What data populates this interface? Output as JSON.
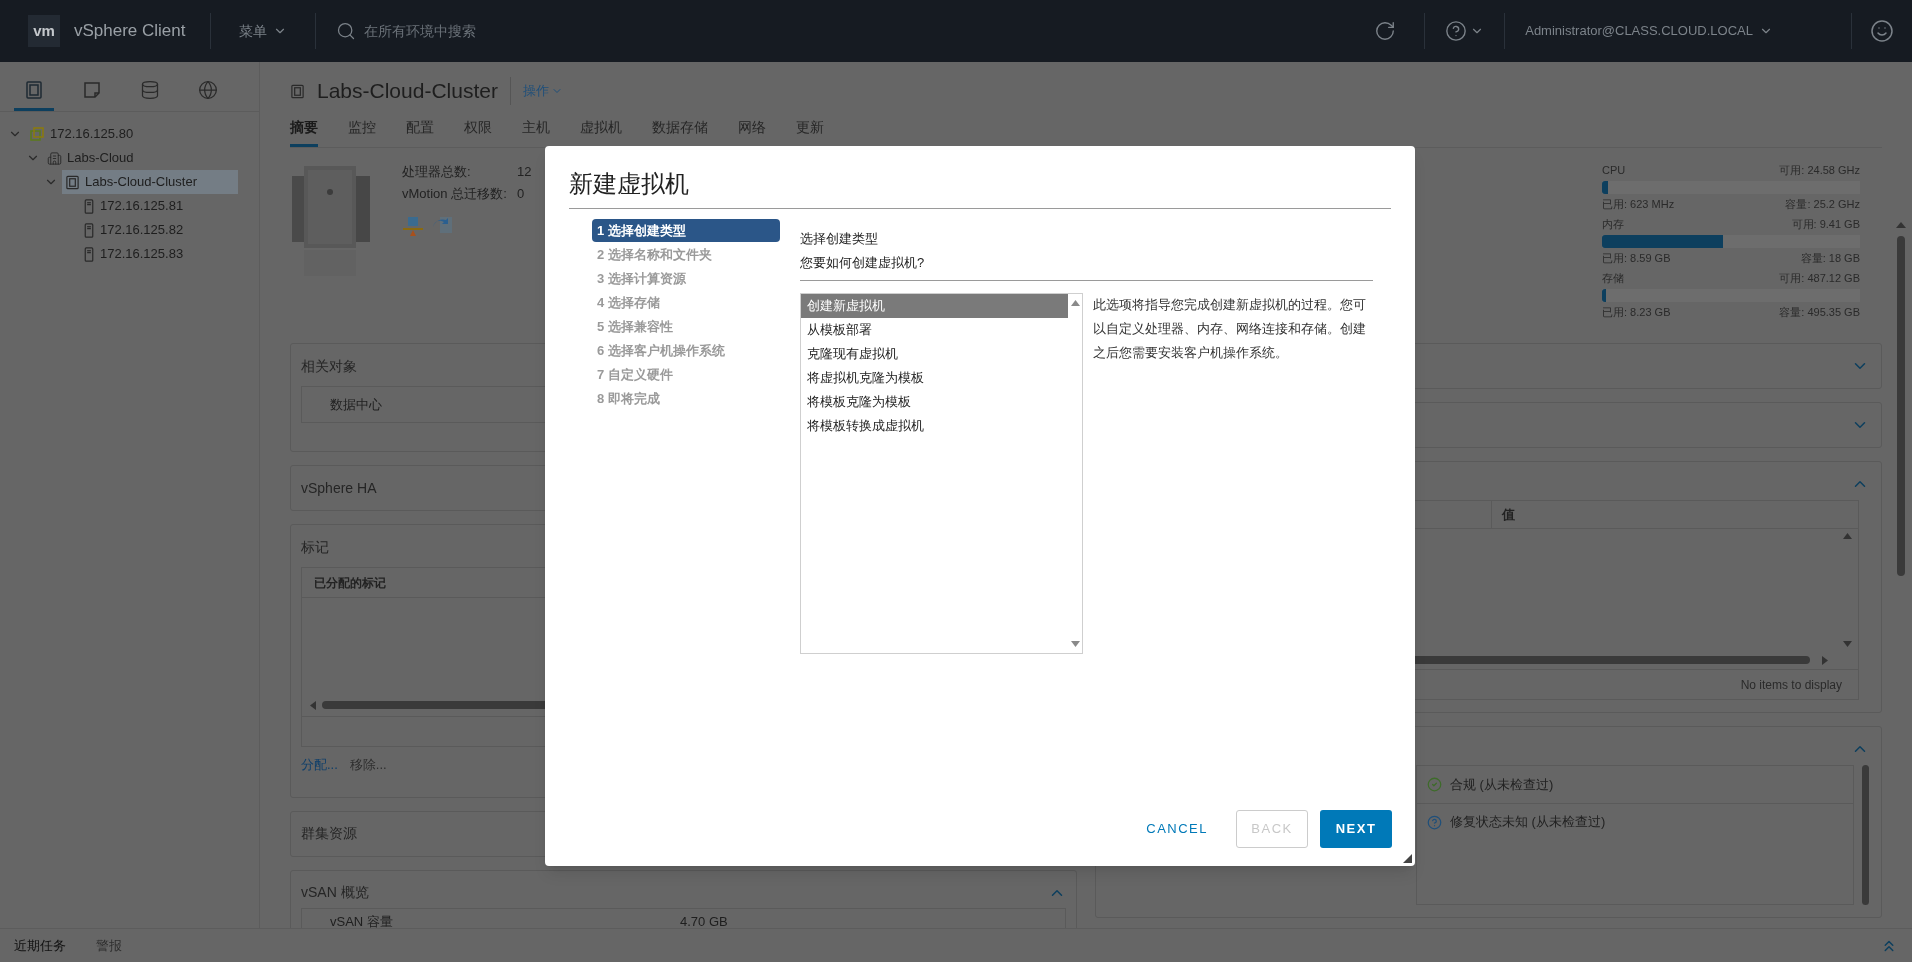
{
  "top_bar": {
    "logo": "vm",
    "app_name": "vSphere Client",
    "menu": "菜单",
    "search_placeholder": "在所有环境中搜索",
    "user": "Administrator@CLASS.CLOUD.LOCAL"
  },
  "sidebar": {
    "tabs": [
      {
        "kind": "hosts",
        "selected": true
      },
      {
        "kind": "vms",
        "selected": false
      },
      {
        "kind": "storage",
        "selected": false
      },
      {
        "kind": "network",
        "selected": false
      }
    ],
    "tree": [
      {
        "label": "172.16.125.80",
        "kind": "vcenter",
        "expanded": true,
        "selected": false,
        "children": [
          {
            "label": "Labs-Cloud",
            "kind": "datacenter",
            "expanded": true,
            "selected": false,
            "children": [
              {
                "label": "Labs-Cloud-Cluster",
                "kind": "cluster",
                "expanded": true,
                "selected": true,
                "children": [
                  {
                    "label": "172.16.125.81",
                    "kind": "host",
                    "selected": false
                  },
                  {
                    "label": "172.16.125.82",
                    "kind": "host",
                    "selected": false
                  },
                  {
                    "label": "172.16.125.83",
                    "kind": "host",
                    "selected": false
                  }
                ]
              }
            ]
          }
        ]
      }
    ]
  },
  "object": {
    "title": "Labs-Cloud-Cluster",
    "actions": "操作"
  },
  "tabs": [
    {
      "label": "摘要",
      "selected": true
    },
    {
      "label": "监控",
      "selected": false
    },
    {
      "label": "配置",
      "selected": false
    },
    {
      "label": "权限",
      "selected": false
    },
    {
      "label": "主机",
      "selected": false
    },
    {
      "label": "虚拟机",
      "selected": false
    },
    {
      "label": "数据存储",
      "selected": false
    },
    {
      "label": "网络",
      "selected": false
    },
    {
      "label": "更新",
      "selected": false
    }
  ],
  "summary": {
    "fields": [
      {
        "label": "处理器总数:",
        "value": "12"
      },
      {
        "label": "vMotion 总迁移数:",
        "value": "0"
      }
    ]
  },
  "resources": [
    {
      "name": "CPU",
      "free": "可用: 24.58 GHz",
      "used": "已用: 623 MHz",
      "capacity": "容量: 25.2 GHz",
      "level": 0.025
    },
    {
      "name": "内存",
      "free": "可用: 9.41 GB",
      "used": "已用: 8.59 GB",
      "capacity": "容量: 18 GB",
      "level": 0.47
    },
    {
      "name": "存储",
      "free": "可用: 487.12 GB",
      "used": "已用: 8.23 GB",
      "capacity": "容量: 495.35 GB",
      "level": 0.017
    }
  ],
  "left_cards": [
    {
      "kind": "related",
      "title": "相关对象",
      "expanded": true,
      "items": [
        "数据中心"
      ]
    },
    {
      "kind": "plain",
      "title": "vSphere HA",
      "expanded": false
    },
    {
      "kind": "tags",
      "title": "标记",
      "expanded": true,
      "column": "已分配的标记",
      "actions": [
        {
          "label": "分配...",
          "disabled": false
        },
        {
          "label": "移除...",
          "disabled": true
        }
      ]
    },
    {
      "kind": "plain",
      "title": "群集资源",
      "expanded": false
    },
    {
      "kind": "vsan",
      "title": "vSAN 概览",
      "expanded": true,
      "row": {
        "label": "vSAN 容量",
        "value": "4.70 GB"
      }
    }
  ],
  "right_cards": [
    {
      "expanded": false
    },
    {
      "expanded": false
    },
    {
      "kind": "table",
      "expanded": true,
      "column": "值",
      "empty_text": "No items to display"
    },
    {
      "kind": "status",
      "expanded": true,
      "items": [
        {
          "kind": "ok",
          "label": "合规 (从未检查过)"
        },
        {
          "kind": "unknown",
          "label": "修复状态未知 (从未检查过)"
        }
      ]
    }
  ],
  "bottom_bar": {
    "tabs": [
      {
        "label": "近期任务",
        "selected": true
      },
      {
        "label": "警报",
        "selected": false
      }
    ]
  },
  "dialog": {
    "title": "新建虚拟机",
    "steps": [
      {
        "label": "1 选择创建类型",
        "selected": true
      },
      {
        "label": "2 选择名称和文件夹",
        "selected": false
      },
      {
        "label": "3 选择计算资源",
        "selected": false
      },
      {
        "label": "4 选择存储",
        "selected": false
      },
      {
        "label": "5 选择兼容性",
        "selected": false
      },
      {
        "label": "6 选择客户机操作系统",
        "selected": false
      },
      {
        "label": "7 自定义硬件",
        "selected": false
      },
      {
        "label": "8 即将完成",
        "selected": false
      }
    ],
    "heading": "选择创建类型",
    "question": "您要如何创建虚拟机?",
    "options": [
      {
        "label": "创建新虚拟机",
        "selected": true
      },
      {
        "label": "从模板部署",
        "selected": false
      },
      {
        "label": "克隆现有虚拟机",
        "selected": false
      },
      {
        "label": "将虚拟机克隆为模板",
        "selected": false
      },
      {
        "label": "将模板克隆为模板",
        "selected": false
      },
      {
        "label": "将模板转换成虚拟机",
        "selected": false
      }
    ],
    "description": "此选项将指导您完成创建新虚拟机的过程。您可以自定义处理器、内存、网络连接和存储。创建之后您需要安装客户机操作系统。",
    "buttons": [
      {
        "kind": "link",
        "label": "CANCEL",
        "disabled": false
      },
      {
        "kind": "outline",
        "label": "BACK",
        "disabled": true
      },
      {
        "kind": "primary",
        "label": "NEXT",
        "disabled": false
      }
    ]
  }
}
